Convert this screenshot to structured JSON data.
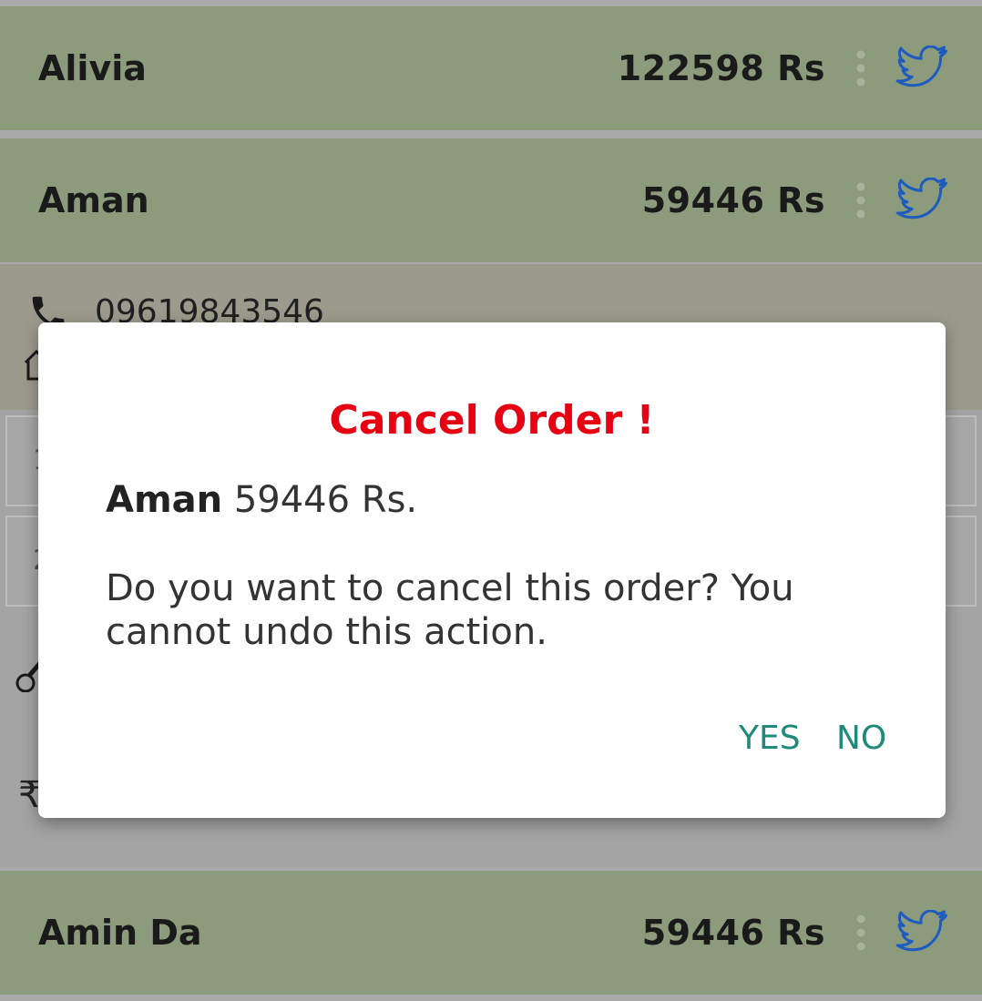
{
  "rows": [
    {
      "name": "Alivia",
      "amount": "122598 Rs"
    },
    {
      "name": "Aman",
      "amount": "59446 Rs"
    },
    {
      "name": "Amin Da",
      "amount": "59446 Rs"
    }
  ],
  "expanded": {
    "phone": "09619843546",
    "item1": "1",
    "item2": "2",
    "rupee_symbol": "₹"
  },
  "dialog": {
    "title": "Cancel Order !",
    "summary_name": "Aman",
    "summary_amount": "59446 Rs.",
    "message": "Do you want to cancel this order? You cannot undo this action.",
    "yes_label": "YES",
    "no_label": "NO"
  },
  "colors": {
    "row_bg": "#8b9b7c",
    "title_red": "#e60012",
    "button_teal": "#1f8a7a",
    "bird_blue": "#1e5bbf"
  },
  "icons": [
    "phone-icon",
    "home-icon",
    "bike-icon",
    "rupee-icon",
    "more-vertical-icon",
    "twitter-bird-icon"
  ]
}
